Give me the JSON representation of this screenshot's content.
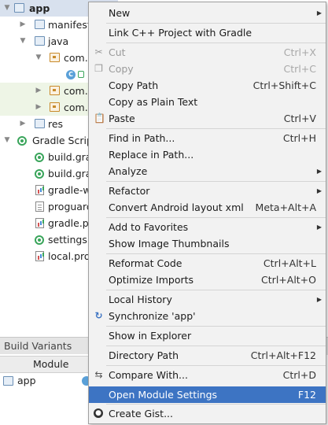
{
  "tree": {
    "items": [
      {
        "label": "app"
      },
      {
        "label": "manifests"
      },
      {
        "label": "java"
      },
      {
        "label": "com.z"
      },
      {
        "label": "com.z"
      },
      {
        "label": "com.z"
      },
      {
        "label": "res"
      },
      {
        "label": "Gradle Scrip"
      },
      {
        "label": "build.gra"
      },
      {
        "label": "build.gra"
      },
      {
        "label": "gradle-w"
      },
      {
        "label": "proguard"
      },
      {
        "label": "gradle.pr"
      },
      {
        "label": "settings.g"
      },
      {
        "label": "local.pro"
      }
    ],
    "class_badge": "C"
  },
  "build_variants": {
    "title": "Build Variants",
    "column": "Module",
    "row_label": "app"
  },
  "menu": {
    "items": [
      {
        "label": "New",
        "shortcut": ""
      },
      {
        "label": "Link C++ Project with Gradle",
        "shortcut": ""
      },
      {
        "label": "Cut",
        "shortcut": "Ctrl+X"
      },
      {
        "label": "Copy",
        "shortcut": "Ctrl+C"
      },
      {
        "label": "Copy Path",
        "shortcut": "Ctrl+Shift+C"
      },
      {
        "label": "Copy as Plain Text",
        "shortcut": ""
      },
      {
        "label": "Paste",
        "shortcut": "Ctrl+V"
      },
      {
        "label": "Find in Path...",
        "shortcut": "Ctrl+H"
      },
      {
        "label": "Replace in Path...",
        "shortcut": ""
      },
      {
        "label": "Analyze",
        "shortcut": ""
      },
      {
        "label": "Refactor",
        "shortcut": ""
      },
      {
        "label": "Convert Android layout xml",
        "shortcut": "Meta+Alt+A"
      },
      {
        "label": "Add to Favorites",
        "shortcut": ""
      },
      {
        "label": "Show Image Thumbnails",
        "shortcut": ""
      },
      {
        "label": "Reformat Code",
        "shortcut": "Ctrl+Alt+L"
      },
      {
        "label": "Optimize Imports",
        "shortcut": "Ctrl+Alt+O"
      },
      {
        "label": "Local History",
        "shortcut": ""
      },
      {
        "label": "Synchronize 'app'",
        "shortcut": ""
      },
      {
        "label": "Show in Explorer",
        "shortcut": ""
      },
      {
        "label": "Directory Path",
        "shortcut": "Ctrl+Alt+F12"
      },
      {
        "label": "Compare With...",
        "shortcut": "Ctrl+D"
      },
      {
        "label": "Open Module Settings",
        "shortcut": "F12"
      },
      {
        "label": "Create Gist...",
        "shortcut": ""
      }
    ]
  },
  "colors": {
    "highlight": "#3d74c3",
    "menu_bg": "#f2f2f2",
    "disabled_text": "#9a9a9a"
  }
}
